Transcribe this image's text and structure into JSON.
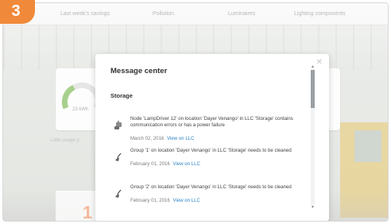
{
  "step": {
    "number": "3",
    "color": "#f08a3a"
  },
  "background": {
    "tabs": [
      "Last week's savings",
      "Pollution",
      "Luminaires",
      "Lighting components"
    ],
    "gauge_value": "23 kWh",
    "low_usage_label": "Little usage p",
    "big_number": "1"
  },
  "modal": {
    "title": "Message center",
    "close_icon": "close-icon",
    "section_title": "Storage",
    "link_color": "#2f84c6",
    "messages": [
      {
        "icon": "lamp-driver-icon",
        "text": "Node 'LampDriver 12' on location 'Dayer Venango' in LLC 'Storage' contains communication errors or has a power failure",
        "date": "March 02, 2016",
        "link": "View on LLC"
      },
      {
        "icon": "broom-icon",
        "text": "Group '1' on location 'Dayer Venango' in LLC 'Storage' needs to be cleaned",
        "date": "February 01, 2016",
        "link": "View on LLC"
      },
      {
        "icon": "broom-icon",
        "text": "Group '2' on location 'Dayer Venango' in LLC 'Storage' needs to be cleaned",
        "date": "February 01, 2016",
        "link": "View on LLC"
      }
    ]
  }
}
